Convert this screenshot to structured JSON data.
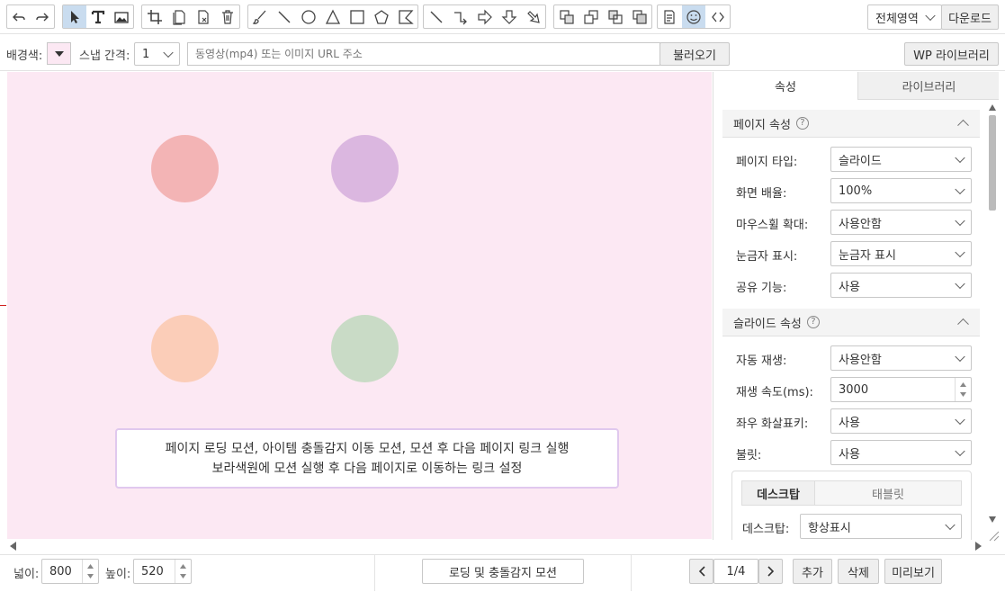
{
  "toolbar": {
    "icons": [
      "undo-icon",
      "redo-icon",
      "select-arrow-icon",
      "text-icon",
      "image-icon",
      "crop-icon",
      "copy-icon",
      "paste-icon",
      "trash-icon",
      "brush-icon",
      "line-icon",
      "circle-icon",
      "triangle-icon",
      "square-icon",
      "pentagon-icon",
      "polyline-icon",
      "diagonal-line-icon",
      "connector-icon",
      "arrow-right-icon",
      "arrow-down-icon",
      "arrow-diagonal-icon",
      "bring-front-icon",
      "bring-forward-icon",
      "send-backward-icon",
      "send-back-icon",
      "page-icon",
      "emoji-icon",
      "code-icon"
    ],
    "area_select": "전체영역",
    "download": "다운로드"
  },
  "options": {
    "bg_label": "배경색:",
    "snap_label": "스냅 간격:",
    "snap_value": "1",
    "url_placeholder": "동영상(mp4) 또는 이미지 URL 주소",
    "load_button": "불러오기",
    "wp_button": "WP 라이브러리"
  },
  "canvas": {
    "background": "#fce8f3",
    "circles": [
      {
        "color": "#f3b4b5"
      },
      {
        "color": "#dbb7e0"
      },
      {
        "color": "#fbcdb8"
      },
      {
        "color": "#c9dbc6"
      }
    ],
    "caption_line1": "페이지 로딩 모션, 아이템 충돌감지 이동 모션, 모션 후 다음 페이지 링크 실행",
    "caption_line2": "보라색원에 모션 실행 후 다음 페이지로 이동하는 링크 설정"
  },
  "panel": {
    "tab_props": "속성",
    "tab_library": "라이브러리",
    "page_section": "페이지 속성",
    "help": "?",
    "page_rows": [
      {
        "label": "페이지 타입:",
        "value": "슬라이드"
      },
      {
        "label": "화면 배율:",
        "value": "100%"
      },
      {
        "label": "마우스휠 확대:",
        "value": "사용안함"
      },
      {
        "label": "눈금자 표시:",
        "value": "눈금자 표시"
      },
      {
        "label": "공유 기능:",
        "value": "사용"
      }
    ],
    "slide_section": "슬라이드 속성",
    "slide_rows": [
      {
        "label": "자동 재생:",
        "value": "사용안함"
      },
      {
        "label": "재생 속도(ms):",
        "value": "3000"
      },
      {
        "label": "좌우 화살표키:",
        "value": "사용"
      },
      {
        "label": "불릿:",
        "value": "사용"
      }
    ],
    "device_tabs": [
      "데스크탑",
      "태블릿"
    ],
    "desktop_label": "데스크탑:",
    "desktop_value": "항상표시"
  },
  "bottom": {
    "width_label": "넓이:",
    "width_value": "800",
    "height_label": "높이:",
    "height_value": "520",
    "motion_button": "로딩 및 충돌감지 모션",
    "page_indicator": "1/4",
    "add_button": "추가",
    "delete_button": "삭제",
    "preview_button": "미리보기"
  }
}
